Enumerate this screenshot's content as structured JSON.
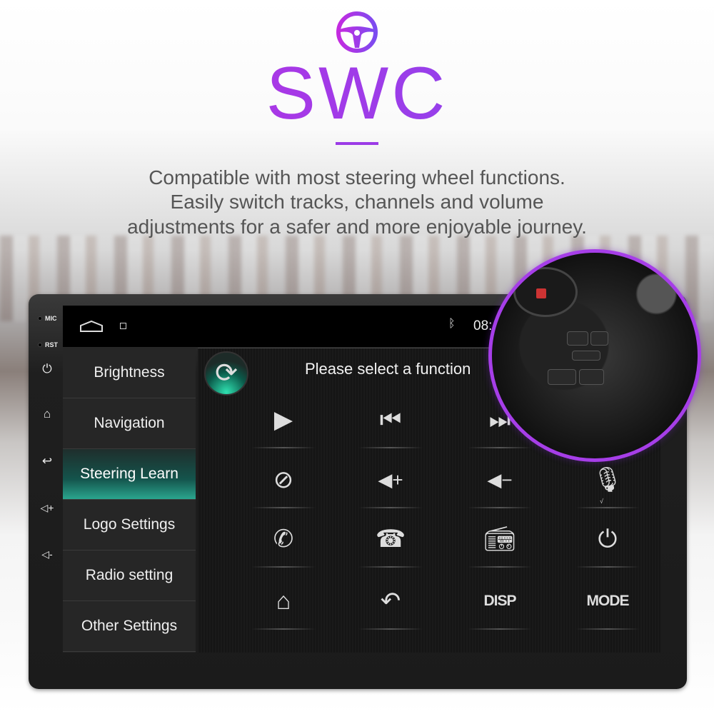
{
  "header": {
    "logo_icon": "steering-wheel-icon",
    "title": "SWC",
    "description": [
      "Compatible with most steering wheel functions.",
      "Easily switch tracks, channels and volume",
      "adjustments for a safer and more enjoyable journey."
    ]
  },
  "device": {
    "labels": {
      "mic": "MIC",
      "rst": "RST"
    },
    "hard_keys": [
      "power-icon",
      "home-icon",
      "back-icon",
      "volume-up-icon",
      "volume-down-icon"
    ]
  },
  "statusbar": {
    "time": "08:",
    "icons": [
      "home-outline-icon",
      "gallery-icon",
      "bluetooth-icon"
    ]
  },
  "sidebar": {
    "items": [
      {
        "label": "Brightness"
      },
      {
        "label": "Navigation"
      },
      {
        "label": "Steering Learn",
        "selected": true
      },
      {
        "label": "Logo Settings"
      },
      {
        "label": "Radio setting"
      },
      {
        "label": "Other Settings"
      }
    ]
  },
  "main": {
    "prompt": "Please select a function",
    "reset_icon": "refresh-icon",
    "functions": [
      "play",
      "previous",
      "next",
      "",
      "mute",
      "volume-up",
      "volume-down",
      "mic",
      "call",
      "hang-up",
      "radio",
      "power",
      "home",
      "back",
      "DISP",
      "MODE"
    ],
    "disp_label": "DISP",
    "mode_label": "MODE",
    "learned_mark": "√"
  },
  "colors": {
    "accent": "#a63ee8",
    "selected": "#2aa58e"
  }
}
